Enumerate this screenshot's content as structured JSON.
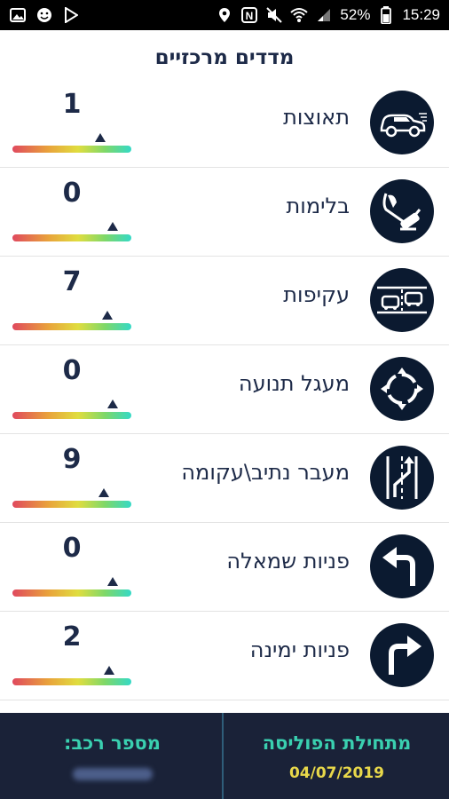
{
  "status_bar": {
    "battery": "52%",
    "time": "15:29",
    "colors": {
      "background": "#000000",
      "text": "#ffffff"
    }
  },
  "screen": {
    "title": "מדדים מרכזיים"
  },
  "metrics": [
    {
      "label": "תאוצות",
      "value": "1",
      "level": 0.74,
      "icon": "car-acceleration-icon"
    },
    {
      "label": "בלימות",
      "value": "0",
      "level": 0.84,
      "icon": "brake-pedal-icon"
    },
    {
      "label": "עקיפות",
      "value": "7",
      "level": 0.8,
      "icon": "overtaking-cars-icon"
    },
    {
      "label": "מעגל תנועה",
      "value": "0",
      "level": 0.84,
      "icon": "roundabout-icon"
    },
    {
      "label": "מעבר נתיב\\עקומה",
      "value": "9",
      "level": 0.77,
      "icon": "lane-change-icon"
    },
    {
      "label": "פניות שמאלה",
      "value": "0",
      "level": 0.84,
      "icon": "turn-left-icon"
    },
    {
      "label": "פניות ימינה",
      "value": "2",
      "level": 0.81,
      "icon": "turn-right-icon"
    }
  ],
  "footer": {
    "policy_start_label": "מתחילת הפוליסה",
    "policy_start_value": "04/07/2019",
    "vehicle_number_label": "מספר רכב:"
  },
  "colors": {
    "title": "#1d2a48",
    "footer_background": "#1a2238",
    "footer_label": "#3ad0b0",
    "footer_value": "#e8d84a",
    "icon_circle": "#0b1a30"
  }
}
